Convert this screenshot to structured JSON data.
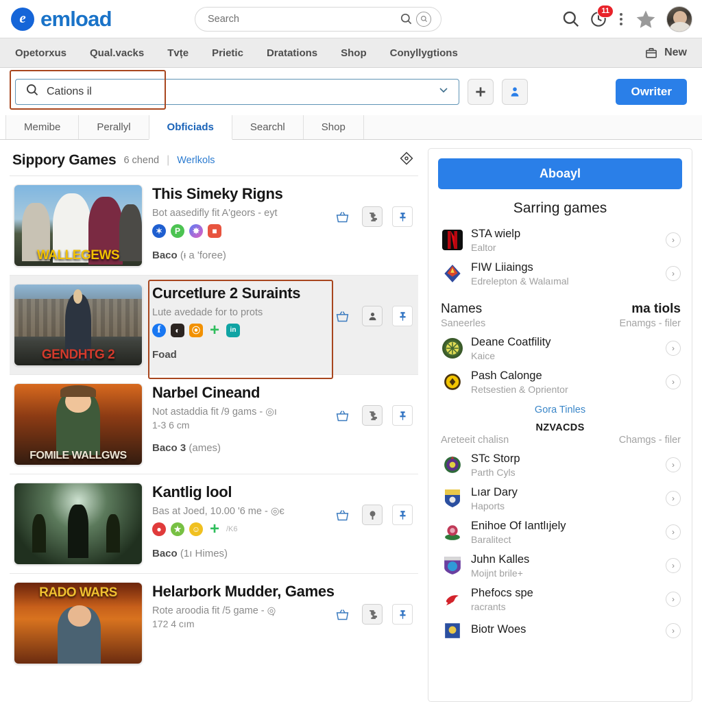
{
  "header": {
    "brand_initial": "e",
    "brand_name": "emload",
    "search_placeholder": "Search",
    "search_value": "",
    "search_icon": "search-icon",
    "lens_icon": "lens-icon",
    "right_icons": {
      "search": "search-icon",
      "history": "history-clock-icon",
      "history_badge": "11",
      "kebab": "kebab-menu-icon",
      "star": "star-icon",
      "avatar": "user-avatar"
    }
  },
  "nav": {
    "items": [
      {
        "label": "Opetorxus"
      },
      {
        "label": "Qual.vacks"
      },
      {
        "label": "Tvțe"
      },
      {
        "label": "Prietic"
      },
      {
        "label": "Dratations"
      },
      {
        "label": "Shop"
      },
      {
        "label": "Conyllygtions"
      }
    ],
    "new_label": "New",
    "new_icon": "archive-box-icon"
  },
  "searchrow": {
    "value": "Cations il",
    "placeholder": "Cations il",
    "search_icon": "search-icon",
    "chevron_icon": "chevron-down-icon",
    "add_button_icon": "plus-icon",
    "person_button_icon": "person-add-icon",
    "primary_button": "Owriter"
  },
  "tabs": [
    {
      "label": "Memibe",
      "active": false
    },
    {
      "label": "Perallyl",
      "active": false
    },
    {
      "label": "Obficiads",
      "active": true
    },
    {
      "label": "Searchl",
      "active": false
    },
    {
      "label": "Shop",
      "active": false
    }
  ],
  "section": {
    "title": "Sippory Games",
    "meta": "6 chend",
    "divider": "|",
    "link": "Werlkols",
    "corner_icon": "diamond-target-icon"
  },
  "list": [
    {
      "title": "This Simeky Rigns",
      "subtitle": "Bot aasedifly fit  A'geors - eyt",
      "subtitle2": "",
      "footer_strong": "Baco",
      "footer_rest": "(ᵻ a 'foree)",
      "thumb_caption": "WALLEGEWS",
      "thumb_caption_color": "#f2c100",
      "socials": [
        {
          "name": "gaming-badge-icon",
          "color": "#1f5fd0",
          "glyph": "✶"
        },
        {
          "name": "chat-bubble-icon",
          "color": "#4cc352",
          "glyph": "P"
        },
        {
          "name": "sparkle-icon",
          "color": "#4b8ede",
          "glyph": "❈"
        },
        {
          "name": "app-tile-icon",
          "color": "#e8543f",
          "glyph": "■",
          "square": true
        }
      ],
      "highlighted": false,
      "alt": false,
      "actions": [
        "basket-icon",
        "puzzle-icon",
        "pin-icon"
      ]
    },
    {
      "title": "Curcetlure 2 Suraints",
      "subtitle": "Lute avedade  for to prots",
      "subtitle2": "",
      "footer_strong": "Foad",
      "footer_rest": "",
      "thumb_caption": "GENDHTG 2",
      "thumb_caption_color": "#d23a2c",
      "socials": [
        {
          "name": "facebook-icon",
          "color": "#1877f2",
          "glyph": "f"
        },
        {
          "name": "dark-app-icon",
          "color": "#2b2420",
          "glyph": "◐",
          "square": true
        },
        {
          "name": "rss-icon",
          "color": "#f29100",
          "glyph": "⦿",
          "square": true
        },
        {
          "name": "plus-icon",
          "color": "",
          "glyph": "+"
        },
        {
          "name": "linkedin-icon",
          "color": "#10a4a4",
          "glyph": "in",
          "square": true
        }
      ],
      "highlighted": true,
      "alt": true,
      "actions": [
        "basket-icon",
        "person-icon",
        "pin-icon"
      ]
    },
    {
      "title": "Narbel Cineand",
      "subtitle": "Not astaddia fit /9 gams - ◎ı",
      "subtitle2": "1-3 6 cm",
      "footer_strong": "Baco 3",
      "footer_rest": "(ames)",
      "thumb_caption": "FOMILE WALLGWS",
      "thumb_caption_color": "#e8e0d0",
      "socials": [],
      "highlighted": false,
      "alt": false,
      "actions": [
        "basket-icon",
        "puzzle-icon",
        "pin-icon"
      ]
    },
    {
      "title": "Kantlig lool",
      "subtitle": "Bas at  Joed, 10.00 '6 me - ◎є",
      "subtitle2": "",
      "footer_strong": "Baco",
      "footer_rest": "(1ı Himes)",
      "thumb_caption": "",
      "thumb_caption_color": "#ffffff",
      "socials": [
        {
          "name": "stop-sign-icon",
          "color": "#e03b3b",
          "glyph": "●"
        },
        {
          "name": "star-creature-icon",
          "color": "#77c043",
          "glyph": "★"
        },
        {
          "name": "emoji-icon",
          "color": "#f0c020",
          "glyph": "☺"
        },
        {
          "name": "plus-icon",
          "color": "",
          "glyph": "+"
        }
      ],
      "socials_more": "/K6",
      "highlighted": false,
      "alt": false,
      "actions": [
        "basket-icon",
        "tree-icon",
        "pin-icon"
      ]
    },
    {
      "title": "Helarbork Mudder, Games",
      "subtitle": "Rote aroodia fit /5 game - ◎̦",
      "subtitle2": "172 4 cım",
      "footer_strong": "",
      "footer_rest": "",
      "thumb_caption": "RADO WARS",
      "thumb_caption_color": "#f0c030",
      "socials": [],
      "highlighted": false,
      "alt": false,
      "actions": [
        "basket-icon",
        "puzzle-icon",
        "pin-icon"
      ]
    }
  ],
  "panel": {
    "cta_label": "Aboayl",
    "heading": "Sarring games",
    "starring": [
      {
        "name": "STA wielp",
        "sub": "Ealtor",
        "icon": "netflix-n-icon",
        "color": "#c40812"
      },
      {
        "name": "FIW Liiaings",
        "sub": "Edrelepton & Walaımal",
        "icon": "shield-crest-icon",
        "color": "#c7452a"
      }
    ],
    "col_head_left": "Names",
    "col_head_right": "ma tiols",
    "col_sub_left": "Saneerles",
    "col_sub_right": "Enamgs - filer",
    "names": [
      {
        "name": "Deane Coatfility",
        "sub": "Kaice",
        "icon": "sunburst-crest-icon",
        "color": "#d8d23c"
      },
      {
        "name": "Pash Calonge",
        "sub": "Retsestien & Oprientor",
        "icon": "gold-coin-crest-icon",
        "color": "#f0c400"
      }
    ],
    "center_link": "Gora Tinles",
    "section2_title": "NZVACDS",
    "sec2_sub_left": "Areteeit chalisn",
    "sec2_sub_right": "Chamgs - filer",
    "nzvacds": [
      {
        "name": "STc Storp",
        "sub": "Parth Cyls",
        "icon": "purple-crest-icon",
        "color": "#5b2f8a"
      },
      {
        "name": "Lıar Dary",
        "sub": "Haports",
        "icon": "blue-shield-icon",
        "color": "#2b4fa0"
      },
      {
        "name": "Enihoe Of Iantlıjely",
        "sub": "Baralitect",
        "icon": "rose-crest-icon",
        "color": "#b53050"
      },
      {
        "name": "Juhn Kalles",
        "sub": "Moijnt brile+",
        "icon": "globe-crest-icon",
        "color": "#6a3fa0"
      },
      {
        "name": "Phefocs spe",
        "sub": "racrants",
        "icon": "red-bird-icon",
        "color": "#d3232b"
      },
      {
        "name": "Biotr Woes",
        "sub": "",
        "icon": "blue-banner-icon",
        "color": "#2b4fa0"
      }
    ],
    "chevron_icon": "chevron-right-icon"
  },
  "colors": {
    "brand_blue": "#1a73c8",
    "accent_blue": "#2a7fe8",
    "highlight_orange": "#a8461e",
    "badge_red": "#e8232a"
  }
}
